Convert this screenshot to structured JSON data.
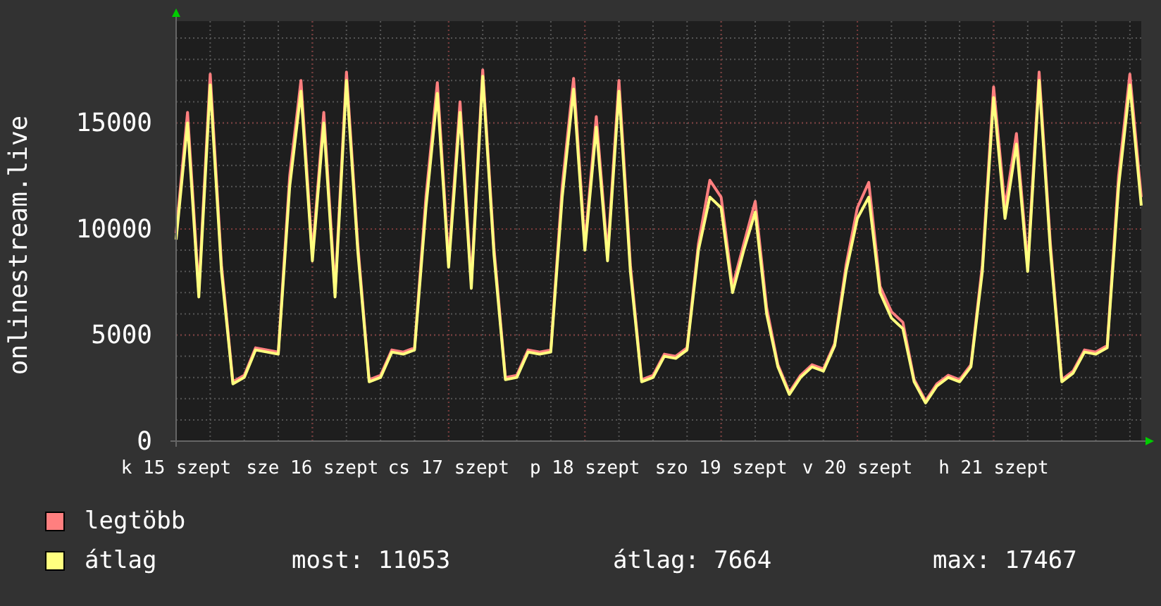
{
  "chart": {
    "chart_data": {
      "type": "line",
      "ylabel": "onlinestream.live",
      "categories": [
        "k 15 szept",
        null,
        null,
        null,
        null,
        null,
        null,
        null,
        null,
        null,
        null,
        null,
        "sze 16 szept",
        null,
        null,
        null,
        null,
        null,
        null,
        null,
        null,
        null,
        null,
        null,
        "cs 17 szept",
        null,
        null,
        null,
        null,
        null,
        null,
        null,
        null,
        null,
        null,
        null,
        "p 18 szept",
        null,
        null,
        null,
        null,
        null,
        null,
        null,
        null,
        null,
        null,
        null,
        "szo 19 szept",
        null,
        null,
        null,
        null,
        null,
        null,
        null,
        null,
        null,
        null,
        null,
        "v 20 szept",
        null,
        null,
        null,
        null,
        null,
        null,
        null,
        null,
        null,
        null,
        null,
        "h 21 szept",
        null,
        null,
        null,
        null,
        null,
        null,
        null,
        null,
        null,
        null,
        null,
        null,
        null
      ],
      "series": [
        {
          "name": "legtöbb",
          "color": "#ff7f7f",
          "values": [
            9800,
            15500,
            7100,
            17300,
            8300,
            2800,
            3100,
            4400,
            4300,
            4200,
            12500,
            17000,
            8800,
            15500,
            7100,
            17400,
            9300,
            2900,
            3100,
            4300,
            4200,
            4400,
            11500,
            16900,
            8500,
            16000,
            7500,
            17500,
            9100,
            3000,
            3100,
            4300,
            4200,
            4300,
            12000,
            17100,
            9300,
            15300,
            8800,
            17000,
            8300,
            2900,
            3100,
            4100,
            4000,
            4400,
            9300,
            12300,
            11500,
            7300,
            9300,
            11300,
            6300,
            3600,
            2300,
            3100,
            3600,
            3400,
            4600,
            8300,
            11000,
            12200,
            7300,
            6100,
            5600,
            2900,
            1900,
            2700,
            3100,
            2900,
            3600,
            8300,
            16700,
            11000,
            14500,
            8300,
            17400,
            9300,
            2900,
            3300,
            4300,
            4200,
            4500,
            12500,
            17300,
            11500
          ]
        },
        {
          "name": "átlag",
          "color": "#ffff7f",
          "values": [
            9500,
            15000,
            6800,
            16800,
            8000,
            2700,
            3000,
            4300,
            4200,
            4100,
            12000,
            16500,
            8500,
            15000,
            6800,
            17000,
            9000,
            2800,
            3000,
            4200,
            4100,
            4300,
            11000,
            16400,
            8200,
            15500,
            7200,
            17200,
            8800,
            2900,
            3000,
            4200,
            4100,
            4200,
            11500,
            16600,
            9000,
            14800,
            8500,
            16500,
            8000,
            2800,
            3000,
            4000,
            3900,
            4300,
            9000,
            11500,
            11000,
            7000,
            9000,
            10800,
            6000,
            3500,
            2200,
            3000,
            3500,
            3300,
            4500,
            8000,
            10500,
            11500,
            7000,
            5800,
            5300,
            2800,
            1800,
            2600,
            3000,
            2800,
            3500,
            8000,
            16200,
            10500,
            14000,
            8000,
            17000,
            9000,
            2800,
            3200,
            4200,
            4100,
            4400,
            12000,
            16800,
            11100
          ]
        }
      ],
      "ylim": [
        0,
        19800
      ],
      "grid": true,
      "yticks": [
        0,
        5000,
        10000,
        15000
      ]
    }
  },
  "legend_stats": [
    "most: 11053",
    "átlag: 7664",
    "max: 17467"
  ]
}
